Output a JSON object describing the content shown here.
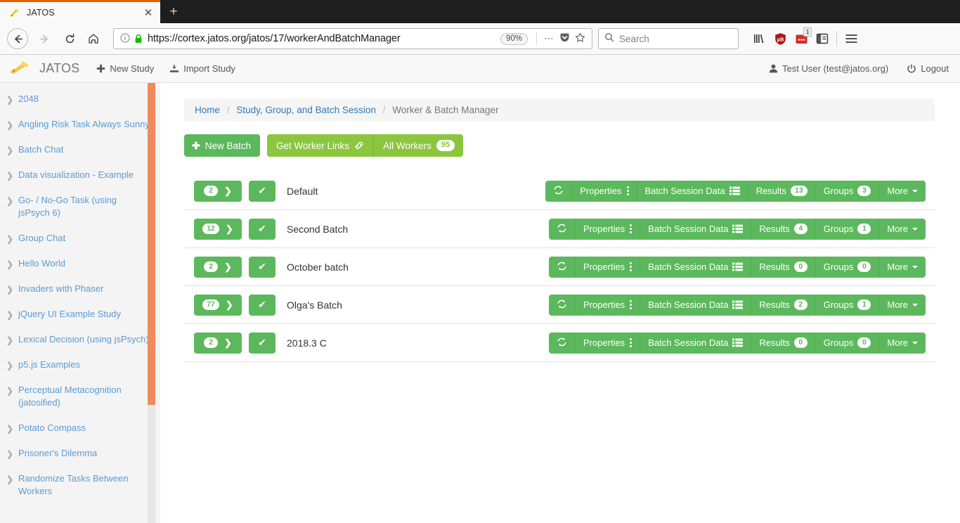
{
  "browser": {
    "tab": {
      "title": "JATOS",
      "favicon_icon": "jatos-logo-icon",
      "close_icon": "close-icon"
    },
    "new_tab_label": "+",
    "nav": {
      "back_icon": "back-arrow-icon",
      "forward_icon": "forward-arrow-icon",
      "reload_icon": "reload-icon",
      "home_icon": "home-icon"
    },
    "url": "https://cortex.jatos.org/jatos/17/workerAndBatchManager",
    "identity_icon": "info-circle-icon",
    "lock_icon": "padlock-icon",
    "zoom_level": "90%",
    "page_actions_icon": "ellipsis-icon",
    "pocket_icon": "pocket-icon",
    "bookmark_icon": "star-icon",
    "search": {
      "placeholder": "Search",
      "icon": "search-icon"
    },
    "toolbar_icons": [
      {
        "name": "library-icon"
      },
      {
        "name": "ublock-origin-icon"
      },
      {
        "name": "lastpass-icon",
        "badge": "1"
      },
      {
        "name": "sidebar-icon"
      }
    ],
    "menu_icon": "hamburger-menu-icon"
  },
  "header": {
    "brand": "JATOS",
    "brand_icon": "jatos-logo-icon",
    "new_study": "New Study",
    "new_study_icon": "plus-icon",
    "import_study": "Import Study",
    "import_study_icon": "import-icon",
    "user": "Test User (test@jatos.org)",
    "user_icon": "user-icon",
    "logout": "Logout",
    "logout_icon": "power-icon"
  },
  "sidebar": {
    "items": [
      {
        "label": "2048"
      },
      {
        "label": "Angling Risk Task Always Sunny"
      },
      {
        "label": "Batch Chat"
      },
      {
        "label": "Data visualization - Example"
      },
      {
        "label": "Go- / No-Go Task (using jsPsych 6)"
      },
      {
        "label": "Group Chat"
      },
      {
        "label": "Hello World"
      },
      {
        "label": "Invaders with Phaser"
      },
      {
        "label": "jQuery UI Example Study"
      },
      {
        "label": "Lexical Decision (using jsPsych)"
      },
      {
        "label": "p5.js Examples"
      },
      {
        "label": "Perceptual Metacognition (jatosified)"
      },
      {
        "label": "Potato Compass"
      },
      {
        "label": "Prisoner's Dilemma"
      },
      {
        "label": "Randomize Tasks Between Workers"
      }
    ]
  },
  "breadcrumb": {
    "home": "Home",
    "study": "Study, Group, and Batch Session",
    "current": "Worker & Batch Manager",
    "separator": "/"
  },
  "toolbar": {
    "new_batch": "New Batch",
    "get_worker_links": "Get Worker Links",
    "all_workers": "All Workers",
    "all_workers_count": "95"
  },
  "actions": {
    "properties": "Properties",
    "batch_session_data": "Batch Session Data",
    "results": "Results",
    "groups": "Groups",
    "more": "More"
  },
  "colors": {
    "green": "#5cb85c",
    "light_green": "#8cc63e",
    "link_blue": "#337ab7",
    "sidebar_link": "#5b9bd5",
    "scrollbar_orange": "#ef8b5f",
    "tab_accent": "#e66000"
  },
  "batches": [
    {
      "workers": "2",
      "active": true,
      "name": "Default",
      "results": "13",
      "groups": "3"
    },
    {
      "workers": "12",
      "active": true,
      "name": "Second Batch",
      "results": "4",
      "groups": "1"
    },
    {
      "workers": "2",
      "active": true,
      "name": "October batch",
      "results": "0",
      "groups": "0"
    },
    {
      "workers": "77",
      "active": true,
      "name": "Olga's Batch",
      "results": "2",
      "groups": "1"
    },
    {
      "workers": "2",
      "active": true,
      "name": "2018.3 C",
      "results": "0",
      "groups": "0"
    }
  ]
}
